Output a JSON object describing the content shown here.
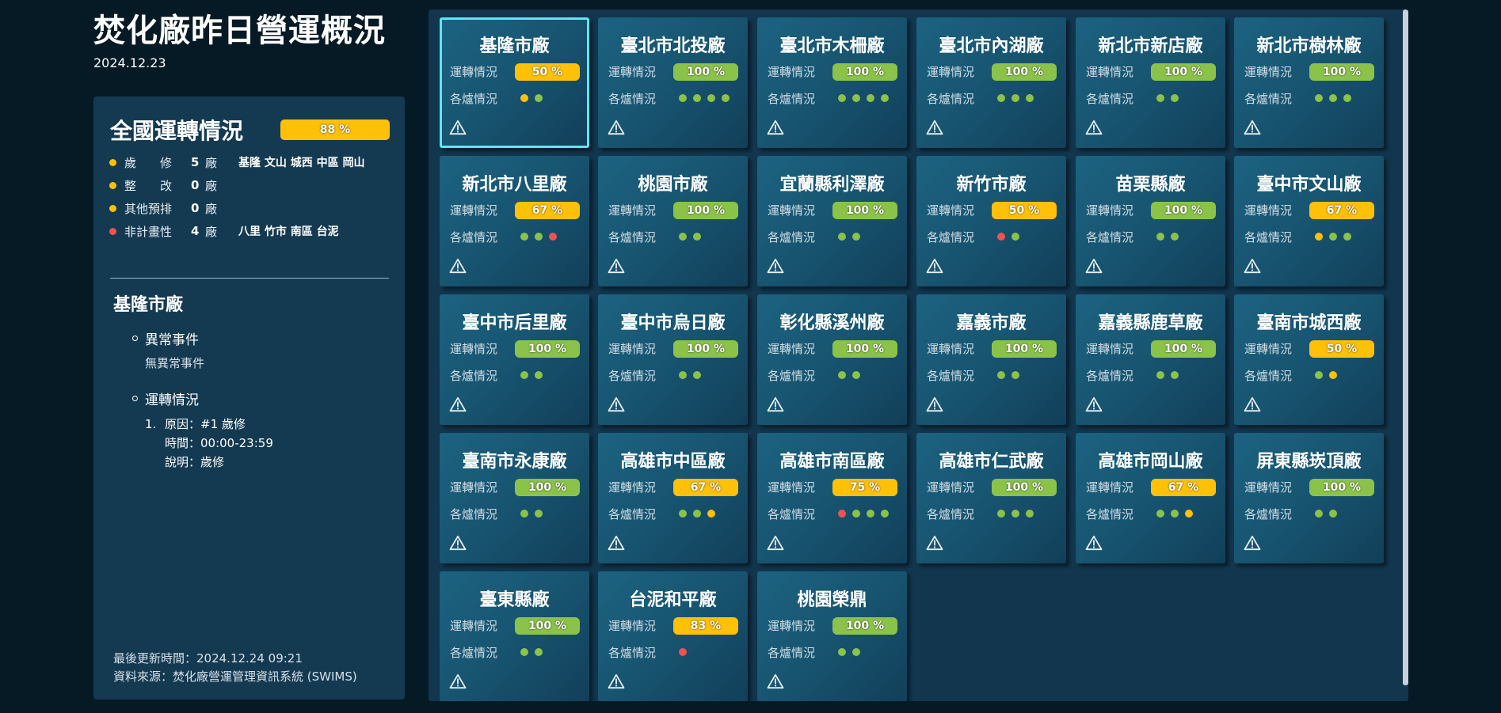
{
  "header": {
    "title": "焚化廠昨日營運概況",
    "date": "2024.12.23"
  },
  "colors": {
    "green": "#8bc34a",
    "yellow": "#ffc107",
    "red": "#ef5350"
  },
  "national": {
    "title": "全國運轉情況",
    "percent_label": "88 %",
    "percent": 88,
    "stats": [
      {
        "label": "歲　　修",
        "count": "5",
        "unit": "廠",
        "color": "yellow",
        "plants": "基隆 文山 城西 中區 岡山"
      },
      {
        "label": "整　　改",
        "count": "0",
        "unit": "廠",
        "color": "yellow",
        "plants": ""
      },
      {
        "label": "其他預排",
        "count": "0",
        "unit": "廠",
        "color": "yellow",
        "plants": ""
      },
      {
        "label": "非計畫性",
        "count": "4",
        "unit": "廠",
        "color": "red",
        "plants": "八里 竹市 南區 台泥"
      }
    ]
  },
  "detail": {
    "plant_name": "基隆市廠",
    "abnormal_label": "異常事件",
    "abnormal_value": "無異常事件",
    "ops_label": "運轉情況",
    "item_number": "1.",
    "item_reason": "原因：#1 歲修",
    "item_time": "時間：00:00-23:59",
    "item_desc": "說明：歲修"
  },
  "footer": {
    "updated": "最後更新時間：2024.12.24 09:21",
    "source": "資料來源：焚化廠營運管理資訊系統 (SWIMS)"
  },
  "labels": {
    "operation": "運轉情況",
    "furnace": "各爐情況"
  },
  "plants": [
    {
      "name": "基隆市廠",
      "percent_label": "50 %",
      "percent": 50,
      "status": "yellow",
      "furnaces": [
        "yellow",
        "green"
      ],
      "selected": true
    },
    {
      "name": "臺北市北投廠",
      "percent_label": "100 %",
      "percent": 100,
      "status": "green",
      "furnaces": [
        "green",
        "green",
        "green",
        "green"
      ]
    },
    {
      "name": "臺北市木柵廠",
      "percent_label": "100 %",
      "percent": 100,
      "status": "green",
      "furnaces": [
        "green",
        "green",
        "green",
        "green"
      ]
    },
    {
      "name": "臺北市內湖廠",
      "percent_label": "100 %",
      "percent": 100,
      "status": "green",
      "furnaces": [
        "green",
        "green",
        "green"
      ]
    },
    {
      "name": "新北市新店廠",
      "percent_label": "100 %",
      "percent": 100,
      "status": "green",
      "furnaces": [
        "green",
        "green"
      ]
    },
    {
      "name": "新北市樹林廠",
      "percent_label": "100 %",
      "percent": 100,
      "status": "green",
      "furnaces": [
        "green",
        "green",
        "green"
      ]
    },
    {
      "name": "新北市八里廠",
      "percent_label": "67 %",
      "percent": 67,
      "status": "yellow",
      "furnaces": [
        "green",
        "green",
        "red"
      ]
    },
    {
      "name": "桃園市廠",
      "percent_label": "100 %",
      "percent": 100,
      "status": "green",
      "furnaces": [
        "green",
        "green"
      ]
    },
    {
      "name": "宜蘭縣利澤廠",
      "percent_label": "100 %",
      "percent": 100,
      "status": "green",
      "furnaces": [
        "green",
        "green"
      ]
    },
    {
      "name": "新竹市廠",
      "percent_label": "50 %",
      "percent": 50,
      "status": "yellow",
      "furnaces": [
        "red",
        "green"
      ]
    },
    {
      "name": "苗栗縣廠",
      "percent_label": "100 %",
      "percent": 100,
      "status": "green",
      "furnaces": [
        "green",
        "green"
      ]
    },
    {
      "name": "臺中市文山廠",
      "percent_label": "67 %",
      "percent": 67,
      "status": "yellow",
      "furnaces": [
        "yellow",
        "green",
        "green"
      ]
    },
    {
      "name": "臺中市后里廠",
      "percent_label": "100 %",
      "percent": 100,
      "status": "green",
      "furnaces": [
        "green",
        "green"
      ]
    },
    {
      "name": "臺中市烏日廠",
      "percent_label": "100 %",
      "percent": 100,
      "status": "green",
      "furnaces": [
        "green",
        "green"
      ]
    },
    {
      "name": "彰化縣溪州廠",
      "percent_label": "100 %",
      "percent": 100,
      "status": "green",
      "furnaces": [
        "green",
        "green"
      ]
    },
    {
      "name": "嘉義市廠",
      "percent_label": "100 %",
      "percent": 100,
      "status": "green",
      "furnaces": [
        "green",
        "green"
      ]
    },
    {
      "name": "嘉義縣鹿草廠",
      "percent_label": "100 %",
      "percent": 100,
      "status": "green",
      "furnaces": [
        "green",
        "green"
      ]
    },
    {
      "name": "臺南市城西廠",
      "percent_label": "50 %",
      "percent": 50,
      "status": "yellow",
      "furnaces": [
        "green",
        "yellow"
      ]
    },
    {
      "name": "臺南市永康廠",
      "percent_label": "100 %",
      "percent": 100,
      "status": "green",
      "furnaces": [
        "green",
        "green"
      ]
    },
    {
      "name": "高雄市中區廠",
      "percent_label": "67 %",
      "percent": 67,
      "status": "yellow",
      "furnaces": [
        "green",
        "green",
        "yellow"
      ]
    },
    {
      "name": "高雄市南區廠",
      "percent_label": "75 %",
      "percent": 75,
      "status": "yellow",
      "furnaces": [
        "red",
        "green",
        "green",
        "green"
      ]
    },
    {
      "name": "高雄市仁武廠",
      "percent_label": "100 %",
      "percent": 100,
      "status": "green",
      "furnaces": [
        "green",
        "green",
        "green"
      ]
    },
    {
      "name": "高雄市岡山廠",
      "percent_label": "67 %",
      "percent": 67,
      "status": "yellow",
      "furnaces": [
        "green",
        "green",
        "yellow"
      ]
    },
    {
      "name": "屏東縣崁頂廠",
      "percent_label": "100 %",
      "percent": 100,
      "status": "green",
      "furnaces": [
        "green",
        "green"
      ]
    },
    {
      "name": "臺東縣廠",
      "percent_label": "100 %",
      "percent": 100,
      "status": "green",
      "furnaces": [
        "green",
        "green"
      ]
    },
    {
      "name": "台泥和平廠",
      "percent_label": "83 %",
      "percent": 83,
      "status": "yellow",
      "furnaces": [
        "red"
      ]
    },
    {
      "name": "桃園榮鼎",
      "percent_label": "100 %",
      "percent": 100,
      "status": "green",
      "furnaces": [
        "green",
        "green"
      ]
    }
  ]
}
